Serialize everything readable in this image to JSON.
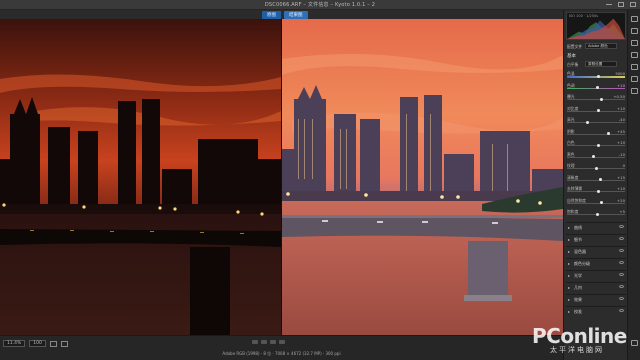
{
  "window": {
    "title": "DSC0066.ARF – 文件信息 – Kyoto 1.0.1 – 2"
  },
  "view_tabs": [
    "原图",
    "结果图"
  ],
  "panel": {
    "histogram_info": "ISO 100 · 1/250s",
    "profile_label": "配置文件",
    "profile_value": "Adobe 颜色",
    "sections": {
      "basic": "基本",
      "white_balance_label": "白平衡",
      "white_balance_value": "原照设置",
      "detail": "细节"
    },
    "sliders": [
      {
        "label": "色温",
        "value": "5000",
        "pos": 0.55,
        "colored": "temp"
      },
      {
        "label": "色调",
        "value": "+10",
        "pos": 0.52,
        "colored": "tint"
      },
      {
        "label": "曝光",
        "value": "+0.50",
        "pos": 0.6
      },
      {
        "label": "对比度",
        "value": "+10",
        "pos": 0.55
      },
      {
        "label": "高光",
        "value": "-40",
        "pos": 0.35
      },
      {
        "label": "阴影",
        "value": "+45",
        "pos": 0.72
      },
      {
        "label": "白色",
        "value": "+10",
        "pos": 0.55
      },
      {
        "label": "黑色",
        "value": "-10",
        "pos": 0.45
      },
      {
        "label": "纹理",
        "value": "0",
        "pos": 0.5
      },
      {
        "label": "清晰度",
        "value": "+15",
        "pos": 0.58
      },
      {
        "label": "去除薄雾",
        "value": "+10",
        "pos": 0.55
      },
      {
        "label": "自然饱和度",
        "value": "+20",
        "pos": 0.6
      },
      {
        "label": "饱和度",
        "value": "+5",
        "pos": 0.52
      }
    ],
    "collapsed_sections": [
      "曲线",
      "细节",
      "混色器",
      "颜色分级",
      "光学",
      "几何",
      "效果",
      "校准"
    ]
  },
  "status": {
    "zoom": "11.4%",
    "zoom2": "100",
    "info": "Adobe RGB (1998) · 8 位 · 7008 × 4672 (32.7 MP) · 300 ppi"
  },
  "watermark": {
    "logo": "PConline",
    "sub": "太平洋电脑网"
  },
  "colors": {
    "accent": "#1f5fa8",
    "sky_before": "#c8421e",
    "sky_after": "#f08a5a"
  }
}
